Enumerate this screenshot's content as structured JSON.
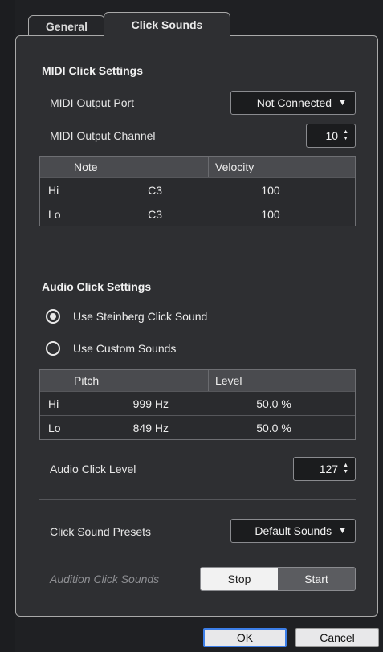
{
  "tabs": [
    {
      "label": "General"
    },
    {
      "label": "Click Sounds"
    }
  ],
  "midi": {
    "title": "MIDI Click Settings",
    "output_port_label": "MIDI Output Port",
    "output_port_value": "Not Connected",
    "output_channel_label": "MIDI Output Channel",
    "output_channel_value": "10",
    "table": {
      "headers": [
        "",
        "Note",
        "Velocity"
      ],
      "rows": [
        [
          "Hi",
          "C3",
          "100"
        ],
        [
          "Lo",
          "C3",
          "100"
        ]
      ]
    }
  },
  "audio": {
    "title": "Audio Click Settings",
    "radio_steinberg": "Use Steinberg Click Sound",
    "radio_custom": "Use Custom Sounds",
    "selected": "steinberg",
    "table": {
      "headers": [
        "",
        "Pitch",
        "Level"
      ],
      "rows": [
        [
          "Hi",
          "999 Hz",
          "50.0 %"
        ],
        [
          "Lo",
          "849 Hz",
          "50.0 %"
        ]
      ]
    },
    "click_level_label": "Audio Click Level",
    "click_level_value": "127"
  },
  "presets": {
    "label": "Click Sound Presets",
    "value": "Default Sounds"
  },
  "audition": {
    "label": "Audition Click Sounds",
    "stop": "Stop",
    "start": "Start"
  },
  "dialog": {
    "ok": "OK",
    "cancel": "Cancel"
  },
  "colors": {
    "background": "#2e2f32",
    "ok_focus": "#3c7ee8"
  }
}
